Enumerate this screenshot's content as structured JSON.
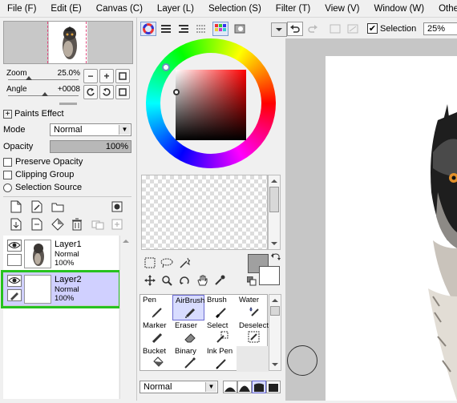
{
  "menu": [
    "File (F)",
    "Edit (E)",
    "Canvas (C)",
    "Layer (L)",
    "Selection (S)",
    "Filter (T)",
    "View (V)",
    "Window (W)",
    "Others"
  ],
  "navigator": {
    "zoom_label": "Zoom",
    "zoom_value": "25.0%",
    "angle_label": "Angle",
    "angle_value": "+0008"
  },
  "layer_props": {
    "paints_effect": "Paints Effect",
    "mode_label": "Mode",
    "mode_value": "Normal",
    "opacity_label": "Opacity",
    "opacity_value": "100%",
    "preserve_opacity": "Preserve Opacity",
    "clipping_group": "Clipping Group",
    "selection_source": "Selection Source"
  },
  "layers": [
    {
      "name": "Layer1",
      "mode": "Normal",
      "opacity": "100%"
    },
    {
      "name": "Layer2",
      "mode": "Normal",
      "opacity": "100%"
    }
  ],
  "tools": [
    {
      "label": "Pen",
      "icon": "pen-icon"
    },
    {
      "label": "AirBrush",
      "icon": "airbrush-icon"
    },
    {
      "label": "Brush",
      "icon": "brush-icon"
    },
    {
      "label": "Water",
      "icon": "water-icon"
    },
    {
      "label": "Marker",
      "icon": "marker-icon"
    },
    {
      "label": "Eraser",
      "icon": "eraser-icon"
    },
    {
      "label": "Select",
      "icon": "select-icon"
    },
    {
      "label": "Deselect",
      "icon": "deselect-icon"
    },
    {
      "label": "Bucket",
      "icon": "bucket-icon"
    },
    {
      "label": "Binary",
      "icon": "binary-icon"
    },
    {
      "label": "Ink Pen",
      "icon": "ink-pen-icon"
    }
  ],
  "blend_mode": "Normal",
  "toolbar": {
    "selection_label": "Selection",
    "selection_checked": true,
    "zoom_value": "25%"
  },
  "colors": {
    "main": "#a0a0a0",
    "sub": "#ffffff",
    "selected_layer_highlight": "#27c21f"
  }
}
